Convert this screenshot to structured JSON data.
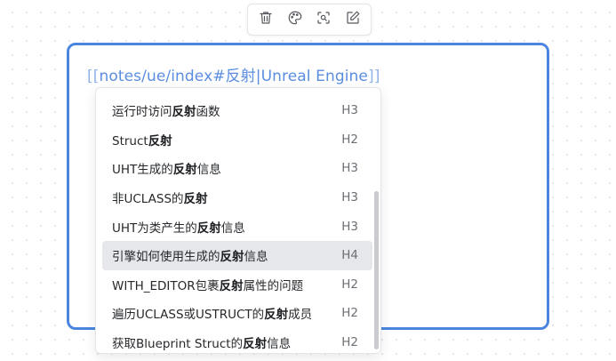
{
  "toolbar": {
    "icons": [
      "trash-icon",
      "palette-icon",
      "focus-icon",
      "edit-icon"
    ]
  },
  "editor": {
    "link_open": "[[",
    "link_text": "notes/ue/index#反射|Unreal Engine",
    "link_close": "]]"
  },
  "dropdown": {
    "selected_index": 5,
    "items": [
      {
        "before": "运行时访问",
        "highlight": "反射",
        "after": "函数",
        "level": "H3"
      },
      {
        "before": "Struct",
        "highlight": "反射",
        "after": "",
        "level": "H2"
      },
      {
        "before": "UHT生成的",
        "highlight": "反射",
        "after": "信息",
        "level": "H3"
      },
      {
        "before": "非UCLASS的",
        "highlight": "反射",
        "after": "",
        "level": "H3"
      },
      {
        "before": "UHT为类产生的",
        "highlight": "反射",
        "after": "信息",
        "level": "H3"
      },
      {
        "before": "引擎如何使用生成的",
        "highlight": "反射",
        "after": "信息",
        "level": "H4"
      },
      {
        "before": "WITH_EDITOR包裹",
        "highlight": "反射",
        "after": "属性的问题",
        "level": "H2"
      },
      {
        "before": "遍历UCLASS或USTRUCT的",
        "highlight": "反射",
        "after": "成员",
        "level": "H2"
      },
      {
        "before": "获取Blueprint Struct的",
        "highlight": "反射",
        "after": "信息",
        "level": "H2"
      }
    ]
  },
  "colors": {
    "accent": "#4a86df",
    "link": "#5b8de0",
    "selected_bg": "#e6e7ea"
  }
}
